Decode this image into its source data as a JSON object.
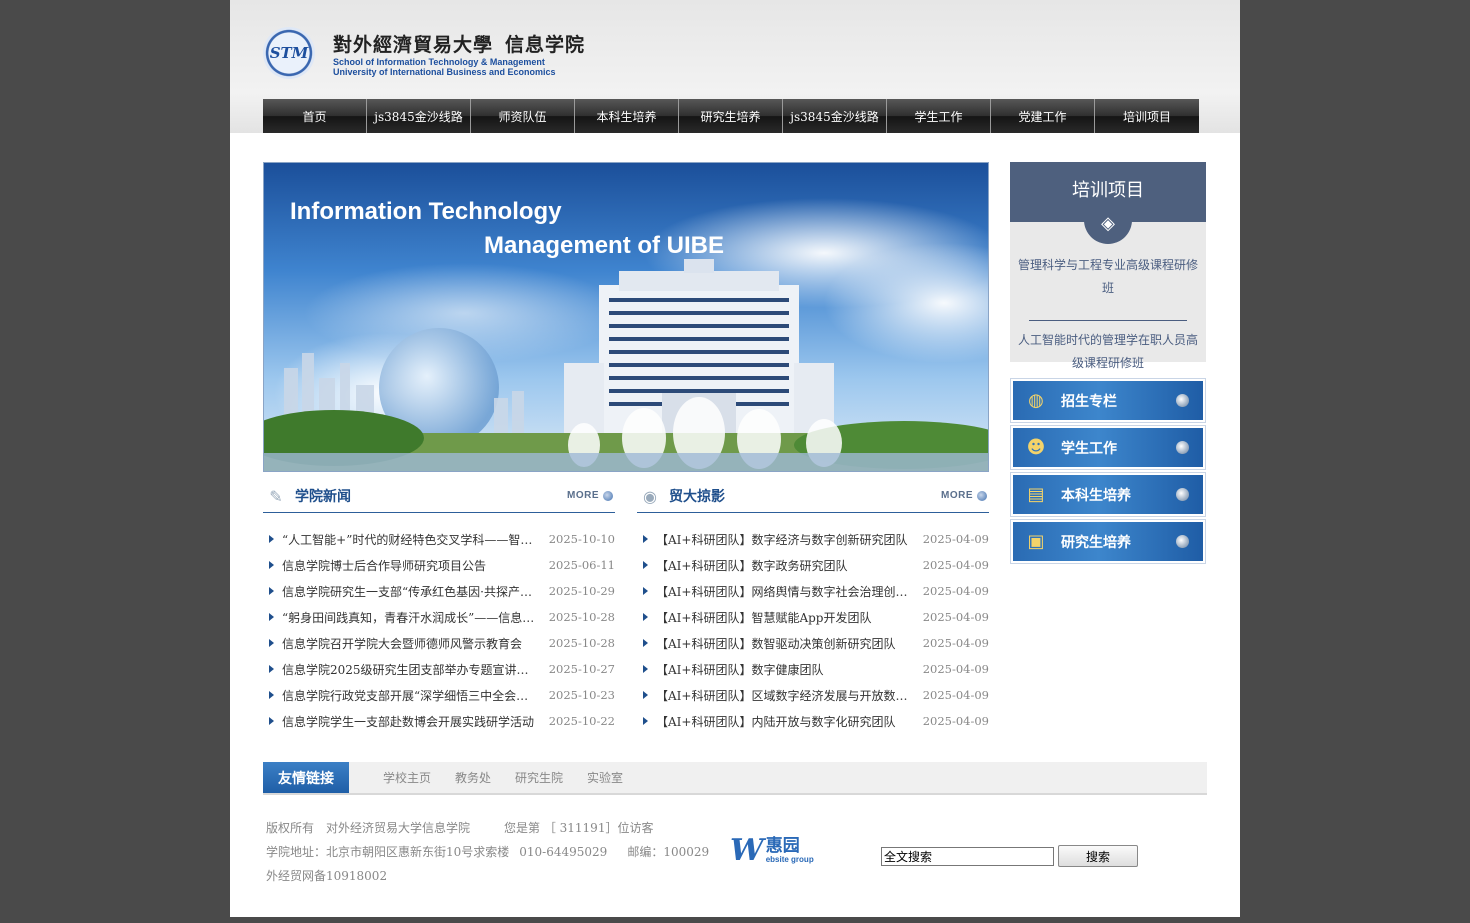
{
  "header": {
    "logo_seal": "STM",
    "logo_school": "對外經濟貿易大學",
    "logo_college": "信息学院",
    "logo_en_1": "School of Information Technology & Management",
    "logo_en_2": "University of International Business and Economics"
  },
  "nav": [
    {
      "label": "首页"
    },
    {
      "label": "js3845金沙线路"
    },
    {
      "label": "师资队伍"
    },
    {
      "label": "本科生培养"
    },
    {
      "label": "研究生培养"
    },
    {
      "label": "js3845金沙线路"
    },
    {
      "label": "学生工作"
    },
    {
      "label": "党建工作"
    },
    {
      "label": "培训项目"
    }
  ],
  "banner": {
    "line1": "Information Technology",
    "line2": "Management of UIBE"
  },
  "training": {
    "title": "培训项目",
    "icon": "layers-icon",
    "items": [
      "管理科学与工程专业高级课程研修班",
      "人工智能时代的管理学在职人员高级课程研修班"
    ]
  },
  "side_menu": [
    {
      "label": "招生专栏",
      "icon": "globe-icon"
    },
    {
      "label": "学生工作",
      "icon": "people-icon"
    },
    {
      "label": "本科生培养",
      "icon": "books-icon"
    },
    {
      "label": "研究生培养",
      "icon": "notebook-icon"
    }
  ],
  "college_news": {
    "title": "学院新闻",
    "more": "MORE",
    "icon": "pencil-icon",
    "items": [
      {
        "text": "“人工智能+”时代的财经特色交叉学科——智能...",
        "date": "2025-10-10"
      },
      {
        "text": "信息学院博士后合作导师研究项目公告",
        "date": "2025-06-11"
      },
      {
        "text": "信息学院研究生一支部“传承红色基因·共探产业...",
        "date": "2025-10-29"
      },
      {
        "text": "“躬身田间践真知，青春汗水润成长”——信息学...",
        "date": "2025-10-28"
      },
      {
        "text": "信息学院召开学院大会暨师德师风警示教育会",
        "date": "2025-10-28"
      },
      {
        "text": "信息学院2025级研究生团支部举办专题宣讲活...",
        "date": "2025-10-27"
      },
      {
        "text": "信息学院行政党支部开展“深学细悟三中全会精神...",
        "date": "2025-10-23"
      },
      {
        "text": "信息学院学生一支部赴数博会开展实践研学活动",
        "date": "2025-10-22"
      }
    ]
  },
  "uibe_photos": {
    "title": "贸大掠影",
    "more": "MORE",
    "icon": "camera-icon",
    "items": [
      {
        "text": "【AI+科研团队】数字经济与数字创新研究团队",
        "date": "2025-04-09"
      },
      {
        "text": "【AI+科研团队】数字政务研究团队",
        "date": "2025-04-09"
      },
      {
        "text": "【AI+科研团队】网络舆情与数字社会治理创新...",
        "date": "2025-04-09"
      },
      {
        "text": "【AI+科研团队】智慧赋能App开发团队",
        "date": "2025-04-09"
      },
      {
        "text": "【AI+科研团队】数智驱动决策创新研究团队",
        "date": "2025-04-09"
      },
      {
        "text": "【AI+科研团队】数字健康团队",
        "date": "2025-04-09"
      },
      {
        "text": "【AI+科研团队】区域数字经济发展与开放数据...",
        "date": "2025-04-09"
      },
      {
        "text": "【AI+科研团队】内陆开放与数字化研究团队",
        "date": "2025-04-09"
      }
    ]
  },
  "links": {
    "label": "友情链接",
    "items": [
      "学校主页",
      "教务处",
      "研究生院",
      "实验室"
    ]
  },
  "footer": {
    "copyright": "版权所有　对外经济贸易大学信息学院",
    "visits_prefix": "您是第 ［ 311191］位访客",
    "address": "学院地址：北京市朝阳区惠新东街10号求索楼",
    "phone": "010-64495029",
    "postcode": "邮编：100029",
    "icp": "外经贸网备10918002"
  },
  "webgroup": {
    "mark": "W",
    "cn": "惠园",
    "en": "ebsite group"
  },
  "search": {
    "value": "全文搜索",
    "button": "搜索"
  },
  "colors": {
    "nav_bg": "#2f2f2f",
    "accent": "#1f4f8c",
    "training_head": "#4e607e"
  }
}
